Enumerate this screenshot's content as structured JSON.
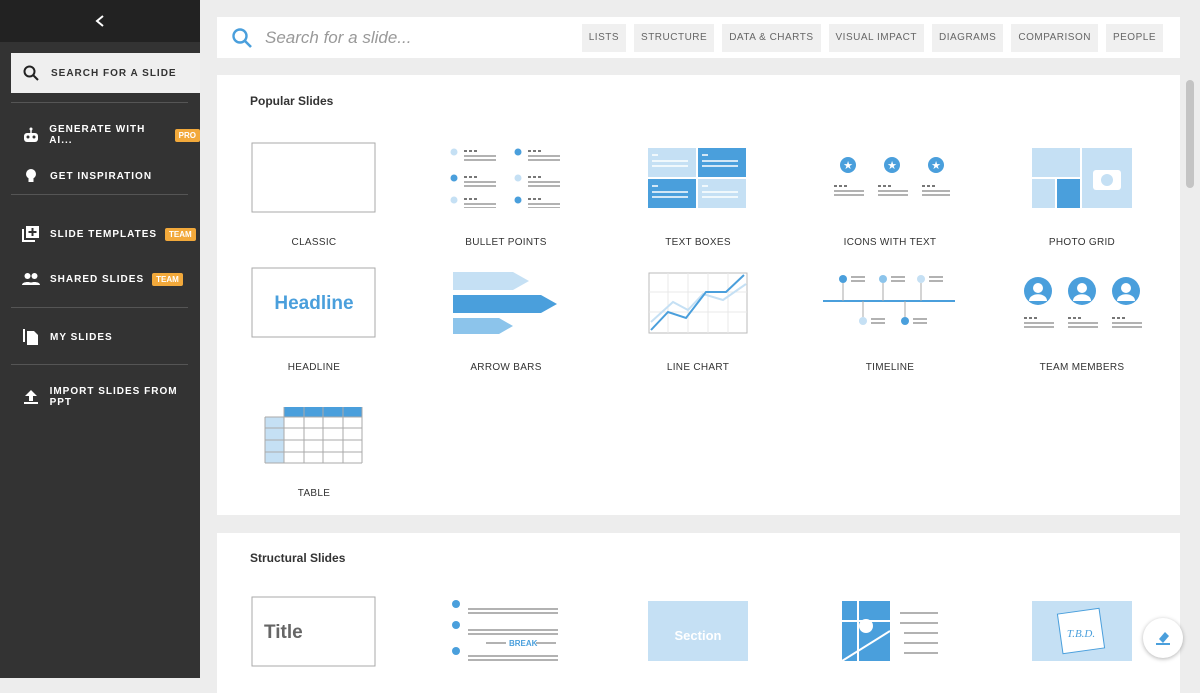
{
  "sidebar": {
    "search": "SEARCH FOR A SLIDE",
    "items": [
      {
        "label": "GENERATE WITH AI...",
        "badge": "PRO",
        "icon": "robot-icon"
      },
      {
        "label": "GET INSPIRATION",
        "icon": "lightbulb-icon"
      },
      {
        "label": "SLIDE TEMPLATES",
        "badge": "TEAM",
        "icon": "add-template-icon"
      },
      {
        "label": "SHARED SLIDES",
        "badge": "TEAM",
        "icon": "people-icon"
      },
      {
        "label": "MY SLIDES",
        "icon": "documents-icon"
      },
      {
        "label": "IMPORT SLIDES FROM PPT",
        "icon": "upload-icon"
      }
    ]
  },
  "search": {
    "placeholder": "Search for a slide...",
    "chips": [
      "LISTS",
      "STRUCTURE",
      "DATA & CHARTS",
      "VISUAL IMPACT",
      "DIAGRAMS",
      "COMPARISON",
      "PEOPLE"
    ]
  },
  "popular": {
    "title": "Popular Slides",
    "cards": [
      "CLASSIC",
      "BULLET POINTS",
      "TEXT BOXES",
      "ICONS WITH TEXT",
      "PHOTO GRID",
      "HEADLINE",
      "ARROW BARS",
      "LINE CHART",
      "TIMELINE",
      "TEAM MEMBERS",
      "TABLE"
    ],
    "headline_text": "Headline"
  },
  "structural": {
    "title": "Structural Slides",
    "title_text": "Title",
    "break_text": "BREAK",
    "section_text": "Section",
    "tbd_text": "T.B.D."
  },
  "colors": {
    "accent": "#4a9fdc",
    "light": "#c5e0f4",
    "badge": "#f2a93b"
  }
}
